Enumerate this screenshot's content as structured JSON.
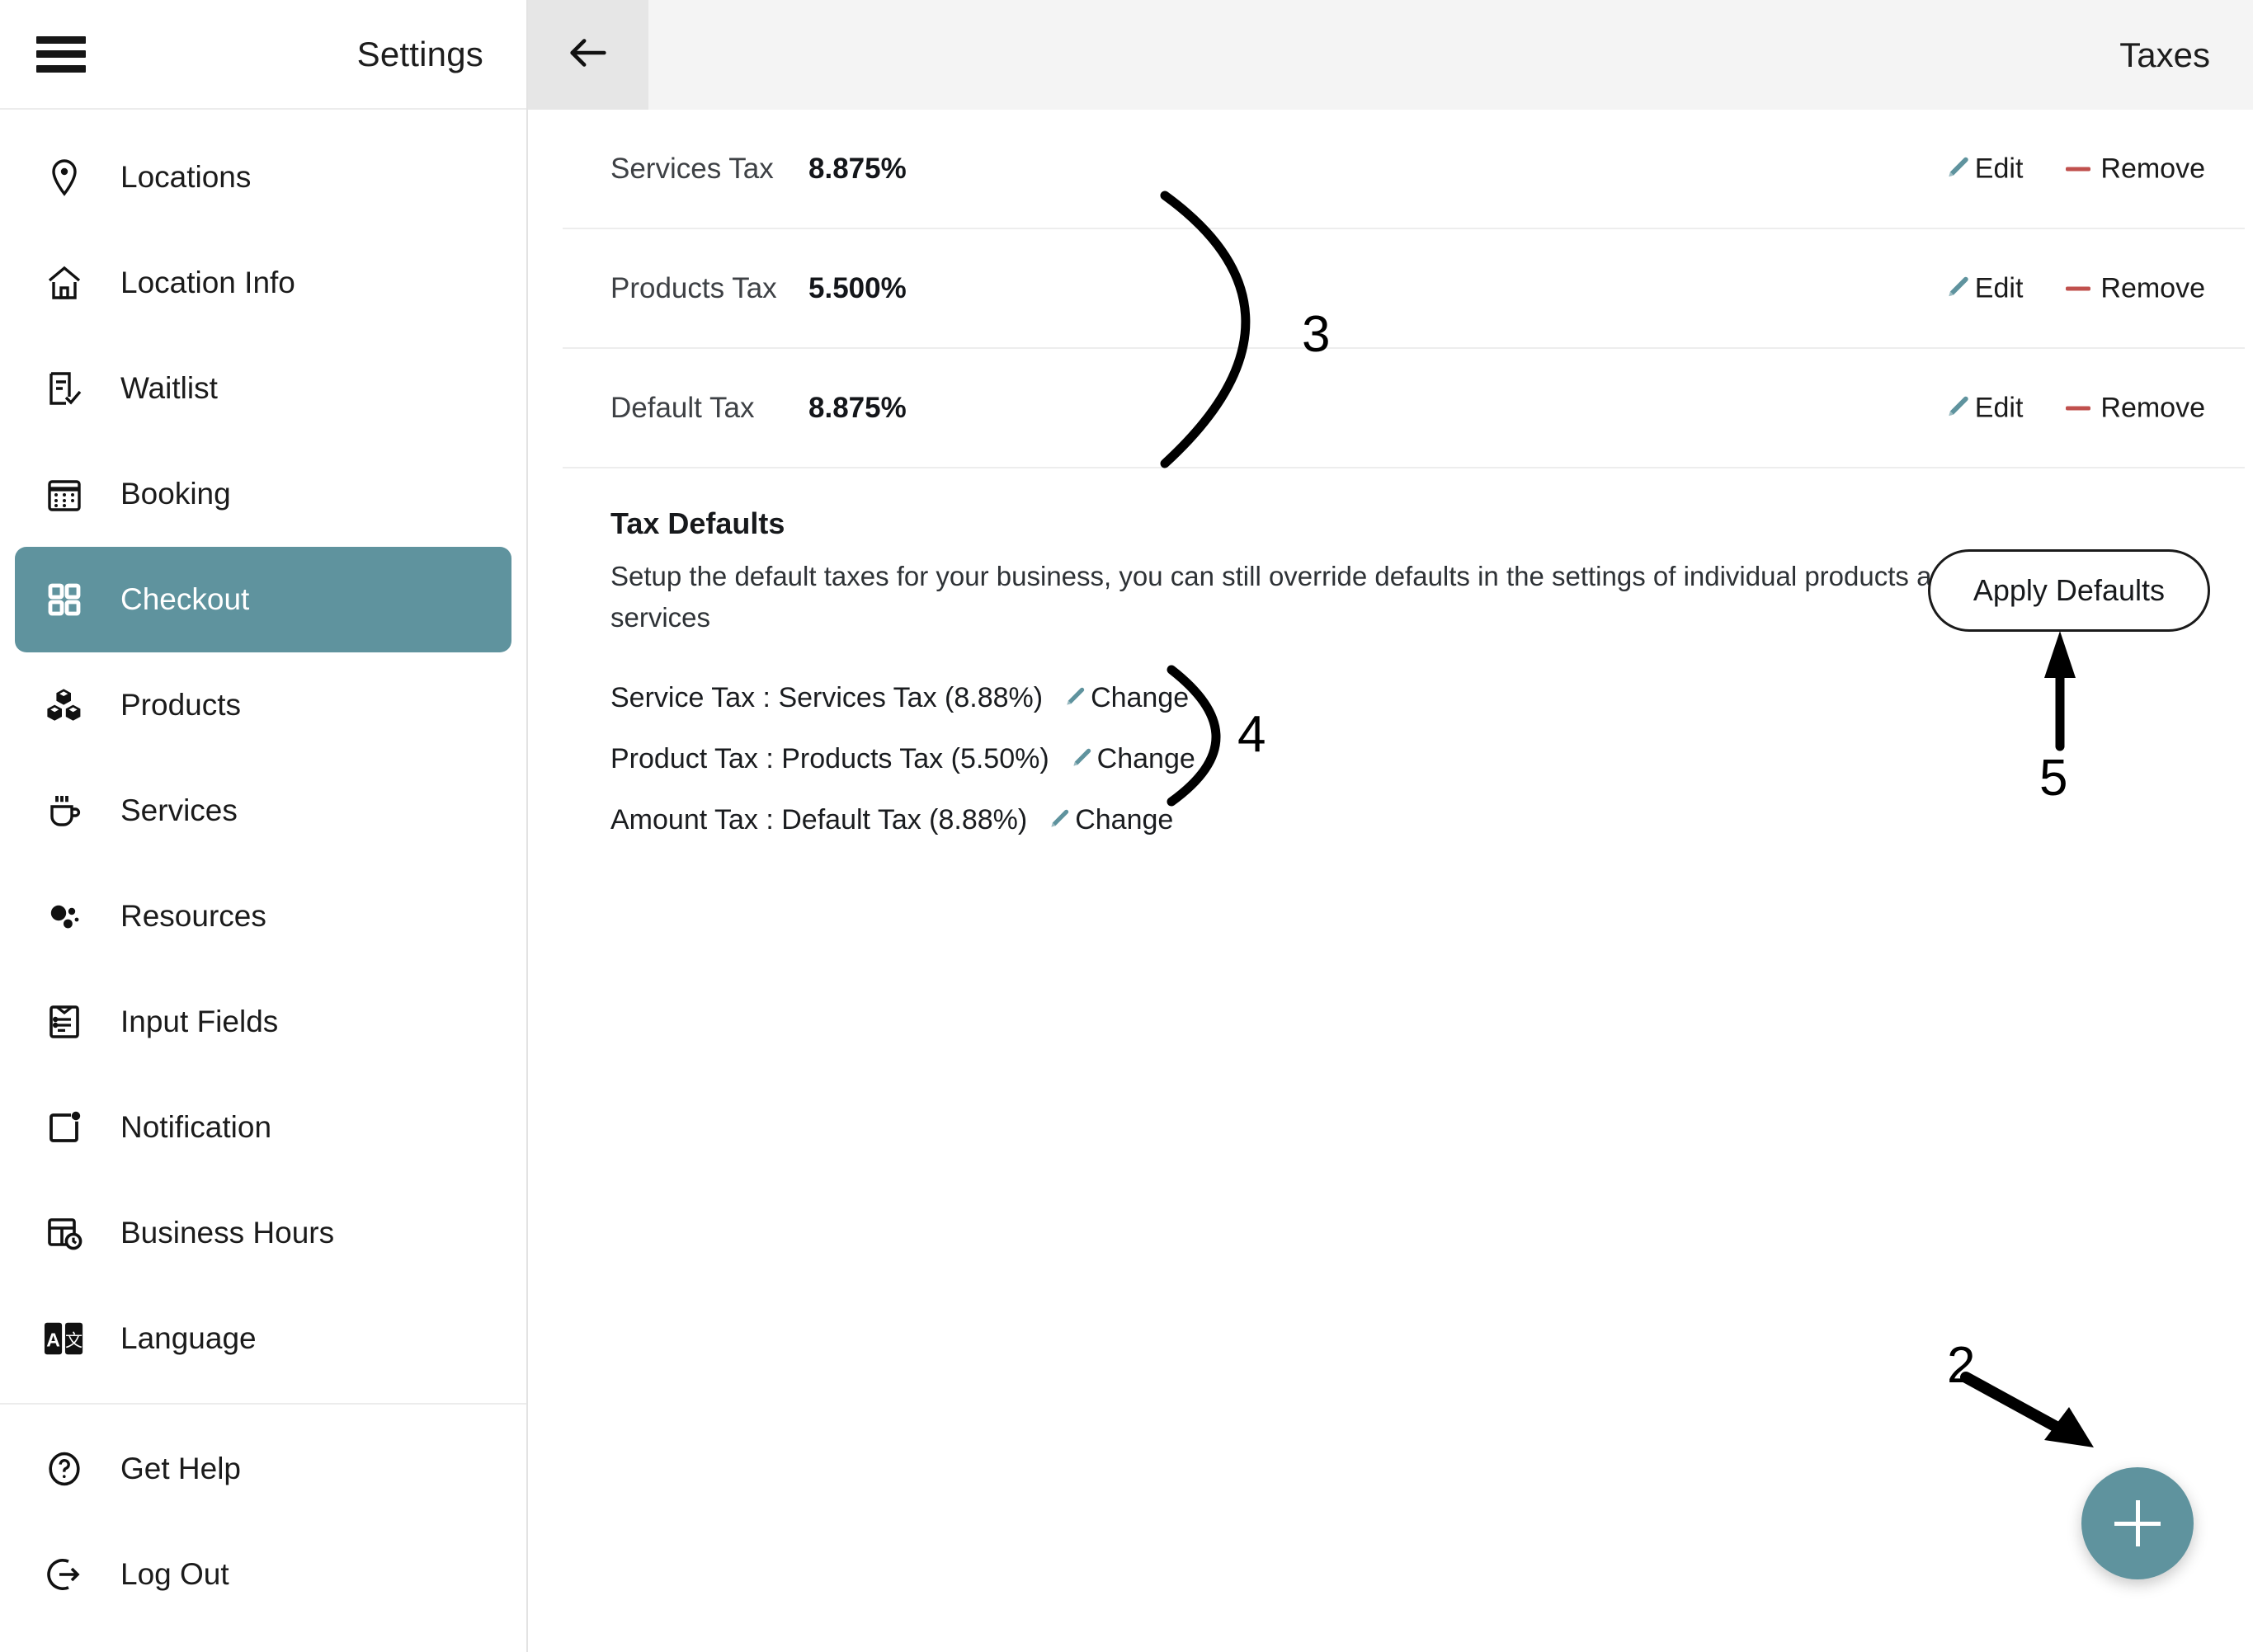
{
  "sidebar": {
    "title": "Settings",
    "menu_icon": "hamburger-menu-icon",
    "items": [
      {
        "label": "Locations",
        "icon": "map-pin-icon"
      },
      {
        "label": "Location Info",
        "icon": "home-icon"
      },
      {
        "label": "Waitlist",
        "icon": "list-check-icon"
      },
      {
        "label": "Booking",
        "icon": "calendar-icon"
      },
      {
        "label": "Checkout",
        "icon": "grid-squares-icon",
        "active": true
      },
      {
        "label": "Products",
        "icon": "boxes-icon"
      },
      {
        "label": "Services",
        "icon": "coffee-cup-icon"
      },
      {
        "label": "Resources",
        "icon": "dots-cluster-icon"
      },
      {
        "label": "Input Fields",
        "icon": "clipboard-form-icon"
      },
      {
        "label": "Notification",
        "icon": "notification-bell-icon"
      },
      {
        "label": "Business Hours",
        "icon": "calendar-clock-icon"
      },
      {
        "label": "Language",
        "icon": "translate-icon"
      }
    ],
    "footer_items": [
      {
        "label": "Get Help",
        "icon": "question-circle-icon"
      },
      {
        "label": "Log Out",
        "icon": "logout-arrow-icon"
      }
    ]
  },
  "header": {
    "back_icon": "arrow-left-icon",
    "page_title": "Taxes"
  },
  "taxes": {
    "rows": [
      {
        "name": "Services Tax",
        "rate": "8.875%",
        "edit_label": "Edit",
        "remove_label": "Remove"
      },
      {
        "name": "Products Tax",
        "rate": "5.500%",
        "edit_label": "Edit",
        "remove_label": "Remove"
      },
      {
        "name": "Default Tax",
        "rate": "8.875%",
        "edit_label": "Edit",
        "remove_label": "Remove"
      }
    ]
  },
  "tax_defaults": {
    "heading": "Tax Defaults",
    "description": "Setup the default taxes for your business, you can still override defaults in the settings of individual products and services",
    "apply_button": "Apply Defaults",
    "rows": [
      {
        "text": "Service Tax : Services Tax (8.88%)",
        "change_label": "Change"
      },
      {
        "text": "Product Tax : Products Tax (5.50%)",
        "change_label": "Change"
      },
      {
        "text": "Amount Tax : Default Tax (8.88%)",
        "change_label": "Change"
      }
    ]
  },
  "fab": {
    "icon": "plus-icon"
  },
  "annotations": [
    {
      "id": "anno-2",
      "label": "2"
    },
    {
      "id": "anno-3",
      "label": "3"
    },
    {
      "id": "anno-4",
      "label": "4"
    },
    {
      "id": "anno-5",
      "label": "5"
    }
  ],
  "colors": {
    "accent_teal": "#5f939e",
    "remove_red": "#c0504d",
    "header_gray": "#f4f4f4",
    "back_gray": "#e6e6e6"
  }
}
